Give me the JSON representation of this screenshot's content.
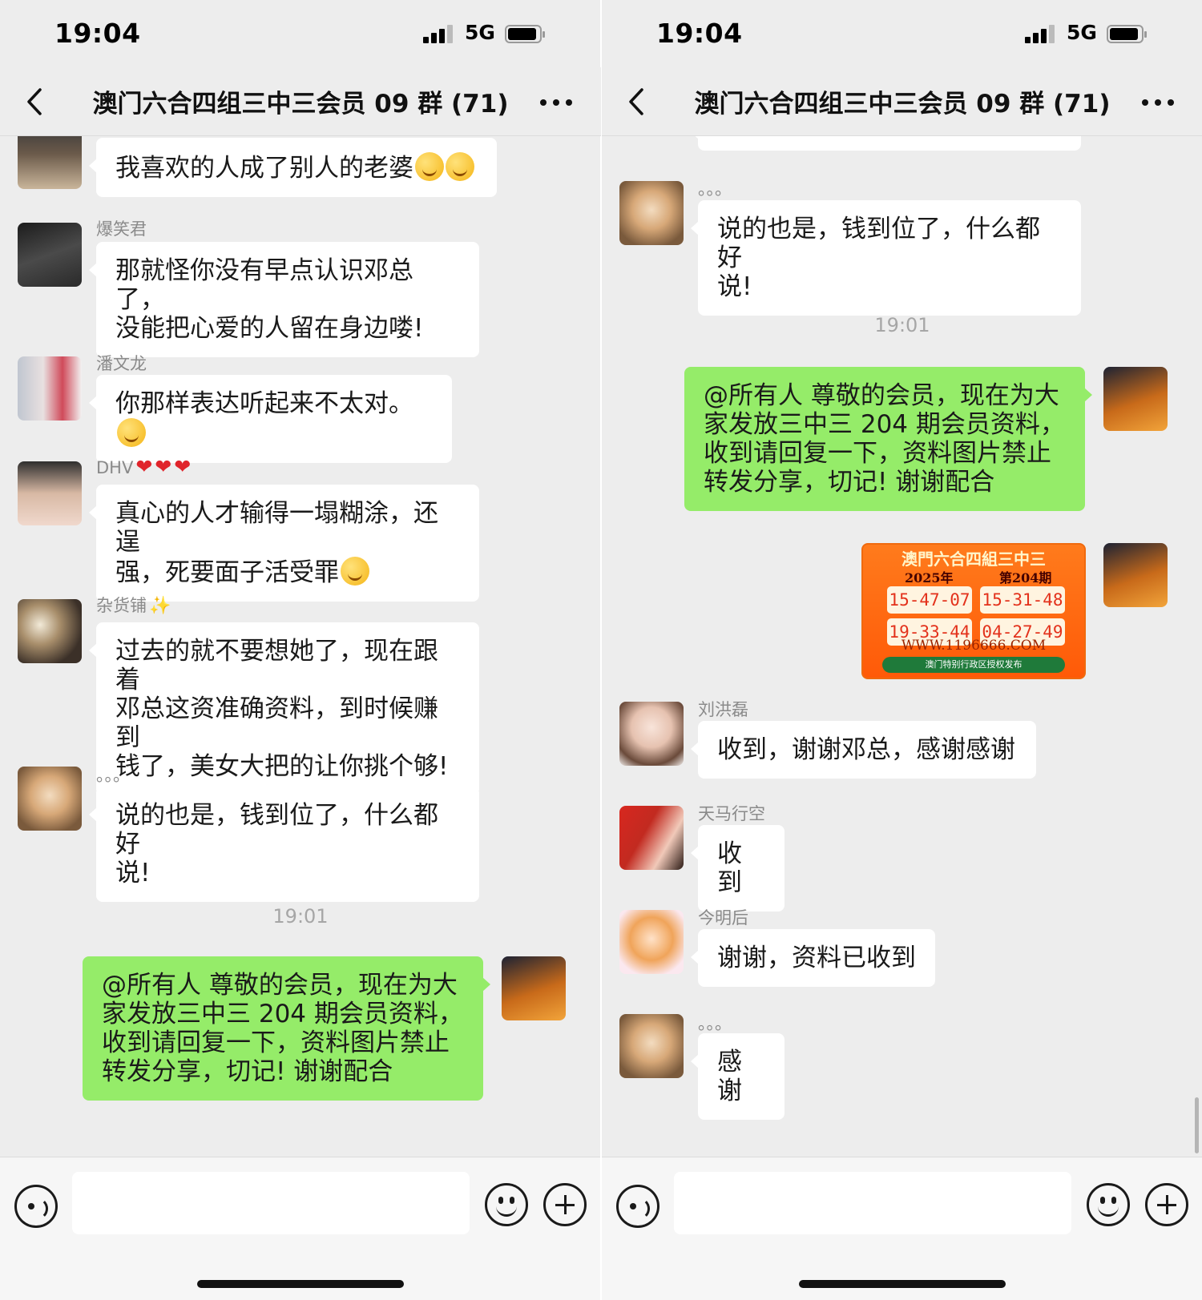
{
  "status": {
    "time": "19:04",
    "network": "5G"
  },
  "chat": {
    "title": "澳门六合四组三中三会员 09 群 (71)"
  },
  "left": {
    "m1": {
      "text": "我喜欢的人成了别人的老婆"
    },
    "m2": {
      "sender": "爆笑君",
      "line1": "那就怪你没有早点认识邓总了，",
      "line2": "没能把心爱的人留在身边喽!"
    },
    "m3": {
      "sender": "潘文龙",
      "text": "你那样表达听起来不太对。"
    },
    "m4": {
      "sender": "DHV",
      "line1": "真心的人才输得一塌糊涂，还逞",
      "line2": "强，死要面子活受罪"
    },
    "m5": {
      "sender": "杂货铺",
      "line1": "过去的就不要想她了，现在跟着",
      "line2": "邓总这资准确资料，到时候赚到",
      "line3": "钱了，美女大把的让你挑个够!"
    },
    "m6": {
      "sender": "。。。",
      "line1": "说的也是，钱到位了，什么都好",
      "line2": "说!"
    },
    "time": "19:01",
    "m7": {
      "line1": "@所有人  尊敬的会员，现在为大",
      "line2": "家发放三中三 204 期会员资料，",
      "line3": "收到请回复一下，资料图片禁止",
      "line4": "转发分享，切记! 谢谢配合"
    }
  },
  "right": {
    "m1": {
      "sender": "。。。",
      "line1": "说的也是，钱到位了，什么都好",
      "line2": "说!"
    },
    "time": "19:01",
    "m2": {
      "line1": "@所有人  尊敬的会员，现在为大",
      "line2": "家发放三中三 204 期会员资料，",
      "line3": "收到请回复一下，资料图片禁止",
      "line4": "转发分享，切记! 谢谢配合"
    },
    "image": {
      "title": "澳門六合四組三中三",
      "year": "2025年",
      "issue": "第204期",
      "numbers": [
        "15-47-07",
        "15-31-48",
        "19-33-44",
        "04-27-49"
      ],
      "url": "WWW.1196666.COM",
      "footer": "澳门特别行政区授权发布"
    },
    "m3": {
      "sender": "刘洪磊",
      "text": "收到，谢谢邓总，感谢感谢"
    },
    "m4": {
      "sender": "天马行空",
      "text": "收到"
    },
    "m5": {
      "sender": "今明后",
      "text": "谢谢，资料已收到"
    },
    "m6": {
      "sender": "。。。",
      "text": "感谢"
    }
  },
  "colors": {
    "background": "#ededed",
    "outgoing_bubble": "#95ec69",
    "incoming_bubble": "#ffffff"
  },
  "icons": [
    "back-icon",
    "more-icon",
    "voice-icon",
    "emoji-icon",
    "plus-icon"
  ]
}
